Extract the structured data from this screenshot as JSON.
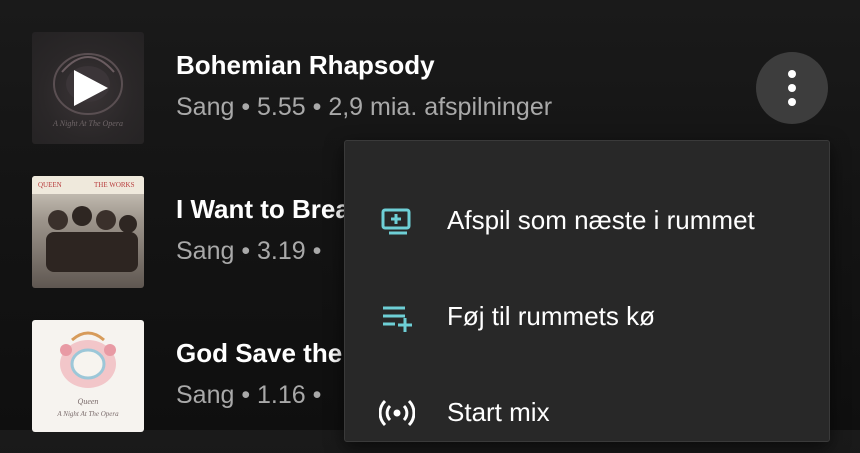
{
  "songs": [
    {
      "title": "Bohemian Rhapsody",
      "subtitle": "Sang • 5.55 • 2,9 mia. afspilninger",
      "art_text_top": "",
      "art_text_bottom": "A Night At The Opera"
    },
    {
      "title": "I Want to Break Free",
      "subtitle": "Sang • 3.19 •",
      "art_text_left": "QUEEN",
      "art_text_right": "THE WORKS"
    },
    {
      "title": "God Save the Queen",
      "subtitle": "Sang • 1.16 •",
      "art_text_top": "Queen",
      "art_text_bottom": "A Night At The Opera"
    }
  ],
  "context_menu": {
    "items": [
      {
        "label": "Afspil som næste i rummet",
        "icon": "queue-next-icon"
      },
      {
        "label": "Føj til rummets kø",
        "icon": "add-to-queue-icon"
      },
      {
        "label": "Start mix",
        "icon": "radio-mix-icon"
      }
    ]
  },
  "colors": {
    "accent_teal": "#6ecfd6",
    "background": "#141414",
    "menu_bg": "#282828",
    "subtitle_gray": "#a9a9a9"
  }
}
